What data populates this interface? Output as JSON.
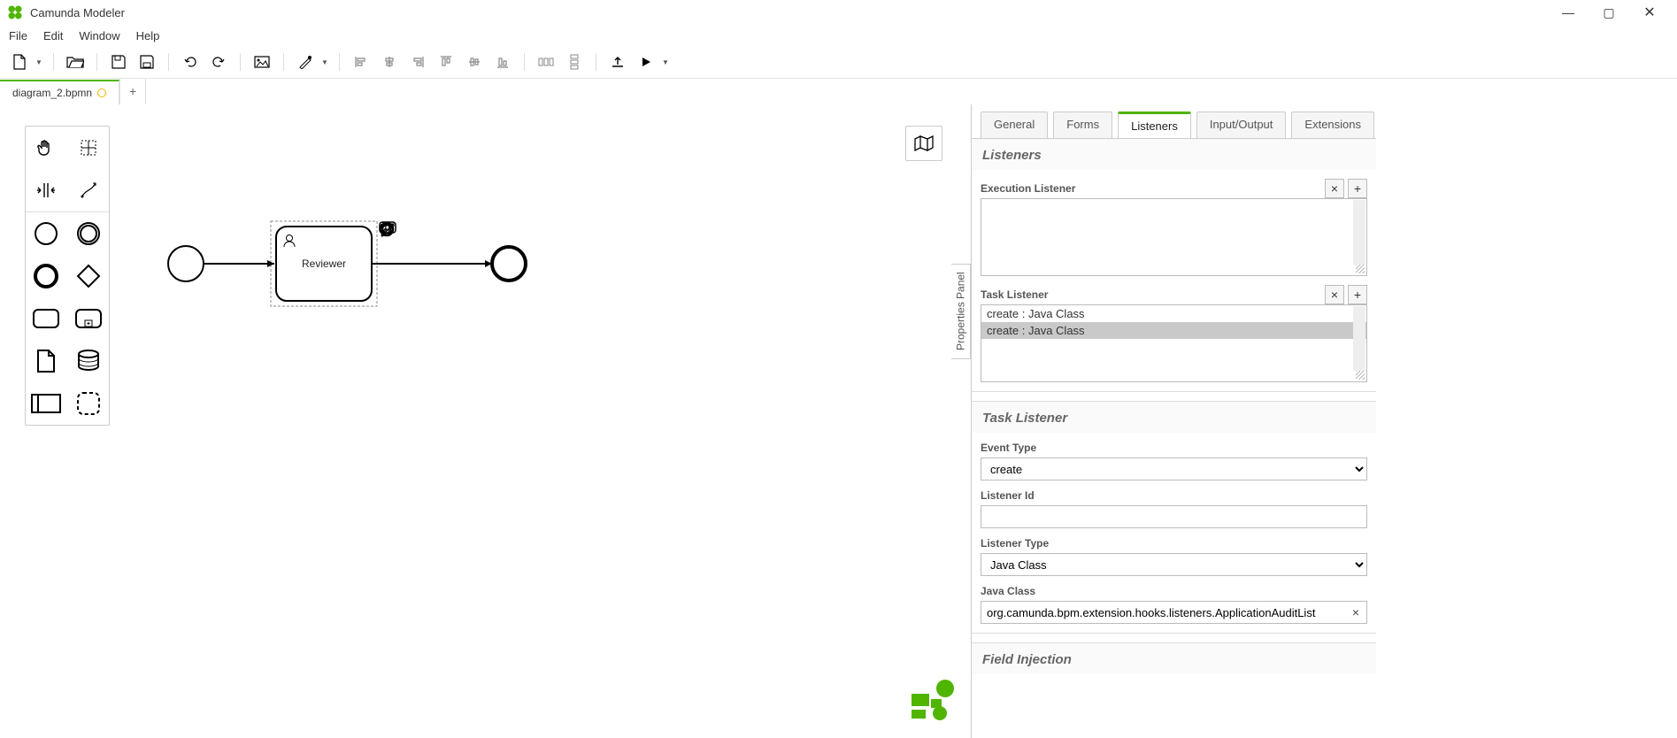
{
  "app": {
    "title": "Camunda Modeler"
  },
  "window_controls": {
    "min": "—",
    "max": "▢",
    "close": "✕"
  },
  "menu": {
    "file": "File",
    "edit": "Edit",
    "window": "Window",
    "help": "Help"
  },
  "tabs": {
    "file_name": "diagram_2.bpmn",
    "new_tab": "+"
  },
  "diagram": {
    "task_label": "Reviewer"
  },
  "props_toggle": "Properties Panel",
  "props_tabs": {
    "general": "General",
    "forms": "Forms",
    "listeners": "Listeners",
    "io": "Input/Output",
    "extensions": "Extensions"
  },
  "listeners": {
    "section_title": "Listeners",
    "execution_listener_label": "Execution Listener",
    "task_listener_label": "Task Listener",
    "task_items": [
      "create : Java Class",
      "create : Java Class"
    ],
    "task_selected_index": 1
  },
  "task_listener_detail": {
    "section_title": "Task Listener",
    "event_type_label": "Event Type",
    "event_type_value": "create",
    "listener_id_label": "Listener Id",
    "listener_id_value": "",
    "listener_type_label": "Listener Type",
    "listener_type_value": "Java Class",
    "java_class_label": "Java Class",
    "java_class_value": "org.camunda.bpm.extension.hooks.listeners.ApplicationAuditList"
  },
  "field_injection": {
    "section_title": "Field Injection"
  },
  "buttons": {
    "remove": "×",
    "add": "+"
  }
}
